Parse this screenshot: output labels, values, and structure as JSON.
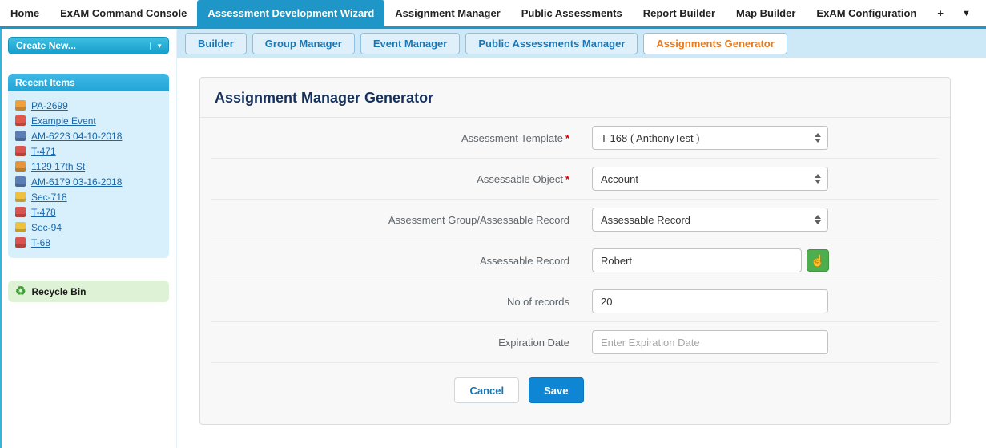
{
  "top_nav": {
    "tabs": [
      {
        "label": "Home"
      },
      {
        "label": "ExAM Command Console"
      },
      {
        "label": "Assessment Development Wizard"
      },
      {
        "label": "Assignment Manager"
      },
      {
        "label": "Public Assessments"
      },
      {
        "label": "Report Builder"
      },
      {
        "label": "Map Builder"
      },
      {
        "label": "ExAM Configuration"
      }
    ],
    "add_tab_label": "+",
    "overflow_label": "▼"
  },
  "sidebar": {
    "create_new": {
      "label": "Create New...",
      "caret": "▼"
    },
    "recent": {
      "title": "Recent Items",
      "items": [
        {
          "label": "PA-2699",
          "icon": "public-assessment-icon",
          "icon_style": "background:#f0a13c"
        },
        {
          "label": "Example Event",
          "icon": "event-icon",
          "icon_style": "background:#e2574c"
        },
        {
          "label": "AM-6223 04-10-2018",
          "icon": "assignment-icon",
          "icon_style": "background:#5b7fb5"
        },
        {
          "label": "T-471",
          "icon": "template-icon",
          "icon_style": "background:#d9534f"
        },
        {
          "label": "1129 17th St",
          "icon": "address-icon",
          "icon_style": "background:#e8953a"
        },
        {
          "label": "AM-6179 03-16-2018",
          "icon": "assignment-icon",
          "icon_style": "background:#5b7fb5"
        },
        {
          "label": "Sec-718",
          "icon": "section-icon",
          "icon_style": "background:#eec13f"
        },
        {
          "label": "T-478",
          "icon": "template-icon",
          "icon_style": "background:#d9534f"
        },
        {
          "label": "Sec-94",
          "icon": "section-icon",
          "icon_style": "background:#eec13f"
        },
        {
          "label": "T-68",
          "icon": "template-icon",
          "icon_style": "background:#d9534f"
        }
      ]
    },
    "recycle_bin": {
      "label": "Recycle Bin",
      "icon": "♻"
    }
  },
  "subtabs": {
    "items": [
      {
        "label": "Builder"
      },
      {
        "label": "Group Manager"
      },
      {
        "label": "Event Manager"
      },
      {
        "label": "Public Assessments Manager"
      },
      {
        "label": "Assignments Generator"
      }
    ]
  },
  "form": {
    "title": "Assignment Manager Generator",
    "required_marker": "*",
    "lookup_icon": "☝",
    "fields": {
      "assessment_template": {
        "label": "Assessment Template",
        "value": "T-168 ( AnthonyTest )"
      },
      "assessable_object": {
        "label": "Assessable Object",
        "value": "Account"
      },
      "group_or_record": {
        "label": "Assessment Group/Assessable Record",
        "value": "Assessable Record"
      },
      "assessable_record": {
        "label": "Assessable Record",
        "value": "Robert"
      },
      "no_of_records": {
        "label": "No of records",
        "value": "20"
      },
      "expiration_date": {
        "label": "Expiration Date",
        "placeholder": "Enter Expiration Date"
      }
    },
    "buttons": {
      "cancel": "Cancel",
      "save": "Save"
    }
  },
  "colors": {
    "nav_active": "#1e96c8",
    "subtab_active_text": "#e5791e",
    "save_button": "#0e86d4",
    "lookup_button": "#4cae4c"
  }
}
